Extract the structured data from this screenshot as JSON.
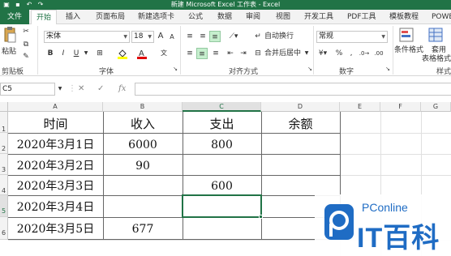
{
  "window": {
    "title": "新建 Microsoft Excel 工作表 - Excel"
  },
  "tabs": [
    "文件",
    "开始",
    "插入",
    "页面布局",
    "新建选项卡",
    "公式",
    "数据",
    "审阅",
    "视图",
    "开发工具",
    "PDF工具",
    "模板教程",
    "POWE"
  ],
  "ribbon": {
    "clipboard": {
      "paste": "粘贴",
      "label": "剪贴板"
    },
    "font": {
      "name": "宋体",
      "size": "18",
      "grow": "A",
      "shrink": "A",
      "bold": "B",
      "italic": "I",
      "underline": "U",
      "label": "字体"
    },
    "alignment": {
      "wrap": "自动换行",
      "merge": "合并后居中",
      "label": "对齐方式"
    },
    "number": {
      "format": "常规",
      "percent": "%",
      "comma": ",",
      "label": "数字"
    },
    "styles": {
      "conditional": "条件格式",
      "table_line1": "套用",
      "table_line2": "表格格式",
      "label": "样式"
    }
  },
  "formula_bar": {
    "name_box": "C5",
    "cancel": "✕",
    "enter": "✓",
    "fx": "fx",
    "value": ""
  },
  "sheet": {
    "columns": [
      "A",
      "B",
      "C",
      "D",
      "E",
      "F",
      "G"
    ],
    "rows": [
      "1",
      "2",
      "3",
      "4",
      "5",
      "6"
    ],
    "headers": [
      "时间",
      "收入",
      "支出",
      "余额"
    ],
    "data": [
      [
        "2020年3月1日",
        "6000",
        "800",
        ""
      ],
      [
        "2020年3月2日",
        "90",
        "",
        ""
      ],
      [
        "2020年3月3日",
        "",
        "600",
        ""
      ],
      [
        "2020年3月4日",
        "",
        "",
        ""
      ],
      [
        "2020年3月5日",
        "677",
        "",
        ""
      ]
    ],
    "selected_cell": "C5"
  },
  "watermark": {
    "top": "PConline",
    "bottom": "IT百科"
  },
  "colors": {
    "accent": "#217346",
    "watermark": "#1f6cc4"
  }
}
